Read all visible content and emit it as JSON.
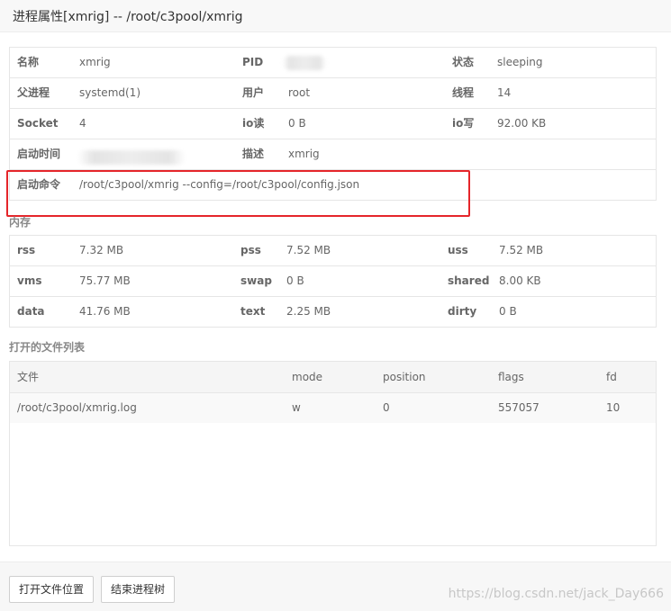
{
  "window": {
    "title": "进程属性[xmrig] -- /root/c3pool/xmrig"
  },
  "process": {
    "rows": [
      [
        {
          "label": "名称",
          "value": "xmrig"
        },
        {
          "label": "PID",
          "value": ""
        },
        {
          "label": "状态",
          "value": "sleeping"
        }
      ],
      [
        {
          "label": "父进程",
          "value": "systemd(1)"
        },
        {
          "label": "用户",
          "value": "root"
        },
        {
          "label": "线程",
          "value": "14"
        }
      ],
      [
        {
          "label": "Socket",
          "value": "4"
        },
        {
          "label": "io读",
          "value": "0 B"
        },
        {
          "label": "io写",
          "value": "92.00 KB"
        }
      ],
      [
        {
          "label": "启动时间",
          "value": ""
        },
        {
          "label": "描述",
          "value": "xmrig"
        }
      ]
    ],
    "command_label": "启动命令",
    "command_value": "/root/c3pool/xmrig --config=/root/c3pool/config.json"
  },
  "memory": {
    "section_title": "内存",
    "rows": [
      [
        {
          "label": "rss",
          "value": "7.32 MB"
        },
        {
          "label": "pss",
          "value": "7.52 MB"
        },
        {
          "label": "uss",
          "value": "7.52 MB"
        }
      ],
      [
        {
          "label": "vms",
          "value": "75.77 MB"
        },
        {
          "label": "swap",
          "value": "0 B"
        },
        {
          "label": "shared",
          "value": "8.00 KB"
        }
      ],
      [
        {
          "label": "data",
          "value": "41.76 MB"
        },
        {
          "label": "text",
          "value": "2.25 MB"
        },
        {
          "label": "dirty",
          "value": "0 B"
        }
      ]
    ]
  },
  "files": {
    "section_title": "打开的文件列表",
    "headers": [
      "文件",
      "mode",
      "position",
      "flags",
      "fd"
    ],
    "rows": [
      [
        "/root/c3pool/xmrig.log",
        "w",
        "0",
        "557057",
        "10"
      ]
    ]
  },
  "footer": {
    "open_location_label": "打开文件位置",
    "kill_tree_label": "结束进程树",
    "watermark": "https://blog.csdn.net/jack_Day666"
  }
}
